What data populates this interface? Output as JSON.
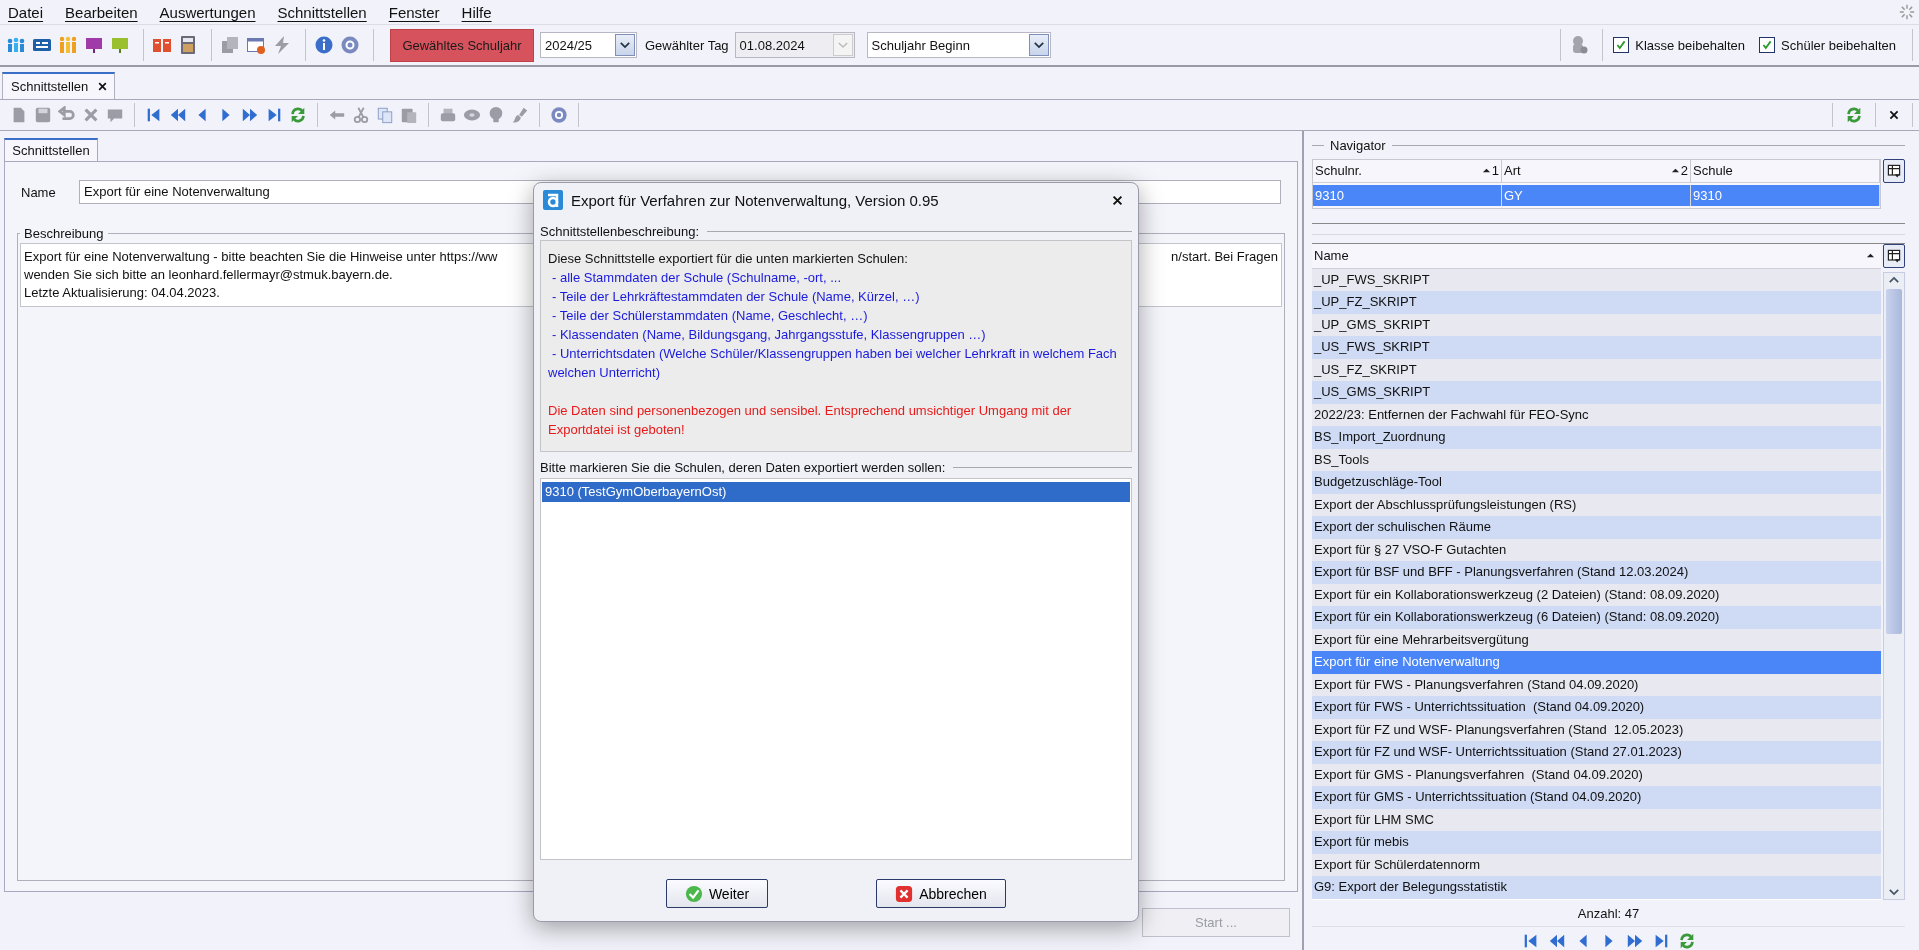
{
  "menu": [
    "Datei",
    "Bearbeiten",
    "Auswertungen",
    "Schnittstellen",
    "Fenster",
    "Hilfe"
  ],
  "toolbar": {
    "school_year_button": "Gewähltes Schuljahr",
    "school_year": "2024/25",
    "day_label": "Gewählter Tag",
    "day": {
      "value": "01.08.2024",
      "disabled": true
    },
    "period": "Schuljahr Beginn",
    "checkboxes": [
      {
        "label": "Klasse beibehalten",
        "checked": true
      },
      {
        "label": "Schüler beibehalten",
        "checked": true
      }
    ]
  },
  "tabs": [
    {
      "label": "Schnittstellen",
      "selected": true
    }
  ],
  "form": {
    "tab": {
      "label": "Schnittstellen",
      "selected": true
    },
    "name_label": "Name",
    "name": "Export für eine Notenverwaltung",
    "description_label": "Beschreibung",
    "description_lines": [
      {
        "start": "Export für eine Notenverwaltung - bitte beachten Sie die Hinweise unter https://ww",
        "end": "n/start. Bei Fragen"
      },
      {
        "start": "wenden Sie sich bitte an leonhard.fellermayr@stmuk.bayern.de."
      },
      {
        "start": "Letzte Aktualisierung: 04.04.2023."
      }
    ],
    "start_button": {
      "label": "Start ...",
      "disabled": true
    }
  },
  "dialog": {
    "title": "Export für Verfahren zur Notenverwaltung, Version 0.95",
    "info_legend": "Schnittstellenbeschreibung:",
    "intro": "Diese Schnittstelle exportiert für die unten markierten Schulen:",
    "items": [
      "- alle Stammdaten der Schule (Schulname, -ort, ...",
      "- Teile der Lehrkräftestammdaten der Schule (Name, Kürzel, …)",
      "- Teile der Schülerstammdaten (Name, Geschlecht, …)",
      "- Klassendaten (Name, Bildungsgang, Jahrgangsstufe, Klassengruppen …)",
      "- Unterrichtsdaten (Welche Schüler/Klassengruppen haben bei welcher Lehrkraft in welchem Fach welchen Unterricht)"
    ],
    "warning": "Die Daten sind personenbezogen und sensibel. Entsprechend umsichtiger Umgang mit der Exportdatei ist geboten!",
    "list_legend": "Bitte markieren Sie die Schulen, deren Daten exportiert werden sollen:",
    "schools": [
      {
        "label": "9310 (TestGymOberbayernOst)",
        "selected": true
      }
    ],
    "buttons": [
      {
        "label": "Weiter",
        "kind": "ok"
      },
      {
        "label": "Abbrechen",
        "kind": "cancel"
      }
    ]
  },
  "navigator": {
    "legend": "Navigator",
    "columns": [
      {
        "label": "Schulnr.",
        "sort": "1"
      },
      {
        "label": "Art",
        "sort": "2"
      },
      {
        "label": "Schule"
      }
    ],
    "rows": [
      {
        "cells": [
          "9310",
          "GY",
          "9310"
        ],
        "selected": true
      }
    ],
    "list_header": "Name",
    "items": [
      {
        "label": "_UP_FWS_SKRIPT",
        "selected": false
      },
      {
        "label": "_UP_FZ_SKRIPT",
        "selected": false
      },
      {
        "label": "_UP_GMS_SKRIPT",
        "selected": false
      },
      {
        "label": "_US_FWS_SKRIPT",
        "selected": false
      },
      {
        "label": "_US_FZ_SKRIPT",
        "selected": false
      },
      {
        "label": "_US_GMS_SKRIPT",
        "selected": false
      },
      {
        "label": "2022/23: Entfernen der Fachwahl für FEO-Sync",
        "selected": false
      },
      {
        "label": "BS_Import_Zuordnung",
        "selected": false
      },
      {
        "label": "BS_Tools",
        "selected": false
      },
      {
        "label": "Budgetzuschläge-Tool",
        "selected": false
      },
      {
        "label": "Export der Abschlussprüfungsleistungen (RS)",
        "selected": false
      },
      {
        "label": "Export der schulischen Räume",
        "selected": false
      },
      {
        "label": "Export für § 27 VSO-F Gutachten",
        "selected": false
      },
      {
        "label": "Export für BSF und BFF - Planungsverfahren (Stand 12.03.2024)",
        "selected": false
      },
      {
        "label": "Export für ein Kollaborationswerkzeug (2 Dateien) (Stand: 08.09.2020)",
        "selected": false
      },
      {
        "label": "Export für ein Kollaborationswerkzeug (6 Dateien) (Stand: 08.09.2020)",
        "selected": false
      },
      {
        "label": "Export für eine Mehrarbeitsvergütung",
        "selected": false
      },
      {
        "label": "Export für eine Notenverwaltung",
        "selected": true
      },
      {
        "label": "Export für FWS - Planungsverfahren (Stand 04.09.2020)",
        "selected": false
      },
      {
        "label": "Export für FWS - Unterrichtssituation  (Stand 04.09.2020)",
        "selected": false
      },
      {
        "label": "Export für FZ und WSF- Planungsverfahren (Stand  12.05.2023)",
        "selected": false
      },
      {
        "label": "Export für FZ und WSF- Unterrichtssituation (Stand 27.01.2023)",
        "selected": false
      },
      {
        "label": "Export für GMS - Planungsverfahren  (Stand 04.09.2020)",
        "selected": false
      },
      {
        "label": "Export für GMS - Unterrichtssituation (Stand 04.09.2020)",
        "selected": false
      },
      {
        "label": "Export für LHM SMC",
        "selected": false
      },
      {
        "label": "Export für mebis",
        "selected": false
      },
      {
        "label": "Export für Schülerdatennorm",
        "selected": false
      },
      {
        "label": "G9: Export der Belegungsstatistik",
        "selected": false
      }
    ],
    "count": "Anzahl: 47"
  }
}
